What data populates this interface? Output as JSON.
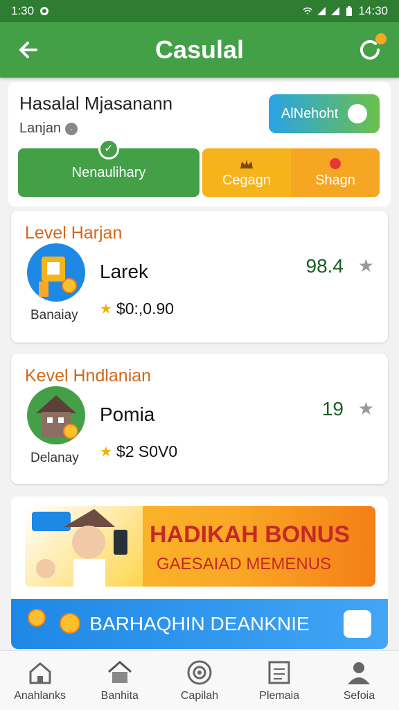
{
  "status": {
    "time": "1:30",
    "right_time": "14:30"
  },
  "app_bar": {
    "title": "Casulal"
  },
  "profile": {
    "name": "Hasalal Mjasanann",
    "subtitle": "Lanjan",
    "action_label": "AlNehoht"
  },
  "tabs": [
    {
      "label": "Nenaulihary"
    },
    {
      "label": "Cegagn"
    },
    {
      "label": "Shagn"
    }
  ],
  "levels": [
    {
      "title": "Level Harjan",
      "avatar_label": "Banaiay",
      "name": "Larek",
      "price": "$0:,0.90",
      "score": "98.4"
    },
    {
      "title": "Kevel Hndlanian",
      "avatar_label": "Delanay",
      "name": "Pomia",
      "price": "$2 S0V0",
      "score": "19"
    }
  ],
  "promo": {
    "title": "HADIKAH BONUS",
    "subtitle": "GAESAIAD MEMENUS"
  },
  "blue_banner": {
    "text": "BARHAQHIN DEANKNIE"
  },
  "nav": [
    {
      "label": "Anahlanks",
      "icon": "home-icon"
    },
    {
      "label": "Banhita",
      "icon": "house-icon"
    },
    {
      "label": "Capilah",
      "icon": "target-icon"
    },
    {
      "label": "Plemaia",
      "icon": "document-icon"
    },
    {
      "label": "Sefoia",
      "icon": "person-icon"
    }
  ],
  "colors": {
    "primary": "#43a047",
    "dark": "#2e7d32",
    "accent": "#f5a623",
    "level_title": "#d4671a"
  }
}
